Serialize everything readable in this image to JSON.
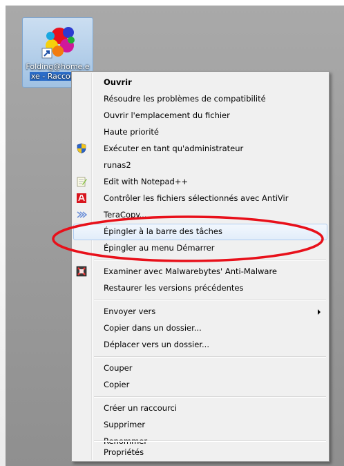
{
  "desktop_icon": {
    "caption_line1": "Folding@home.e",
    "caption_line2": "xe - Raccourci"
  },
  "menu": {
    "items": [
      {
        "label": "Ouvrir"
      },
      {
        "label": "Résoudre les problèmes de compatibilité"
      },
      {
        "label": "Ouvrir l'emplacement du fichier"
      },
      {
        "label": "Haute priorité"
      },
      {
        "label": "Exécuter en tant qu'administrateur"
      },
      {
        "label": "runas2"
      },
      {
        "label": "Edit with Notepad++"
      },
      {
        "label": "Contrôler les fichiers sélectionnés avec AntiVir"
      },
      {
        "label": "TeraCopy..."
      },
      {
        "label": "Épingler à la barre des tâches"
      },
      {
        "label": "Épingler au menu Démarrer"
      },
      {
        "label": "Examiner avec Malwarebytes' Anti-Malware"
      },
      {
        "label": "Restaurer les versions précédentes"
      },
      {
        "label": "Envoyer vers"
      },
      {
        "label": "Copier dans un dossier..."
      },
      {
        "label": "Déplacer vers un dossier..."
      },
      {
        "label": "Couper"
      },
      {
        "label": "Copier"
      },
      {
        "label": "Créer un raccourci"
      },
      {
        "label": "Supprimer"
      },
      {
        "label": "Renommer"
      },
      {
        "label": "Propriétés"
      }
    ]
  },
  "icons": {
    "uac": "shield-icon",
    "notepad": "notepad-plus-plus-icon",
    "antivir": "antivir-umbrella-icon",
    "teracopy": "teracopy-icon",
    "malwarebytes": "malwarebytes-icon",
    "submenu": "chevron-right-icon"
  },
  "colors": {
    "highlight_ellipse": "#e8101a",
    "hover_border": "#aeccf0",
    "selection_blue": "#2b6dc9"
  }
}
